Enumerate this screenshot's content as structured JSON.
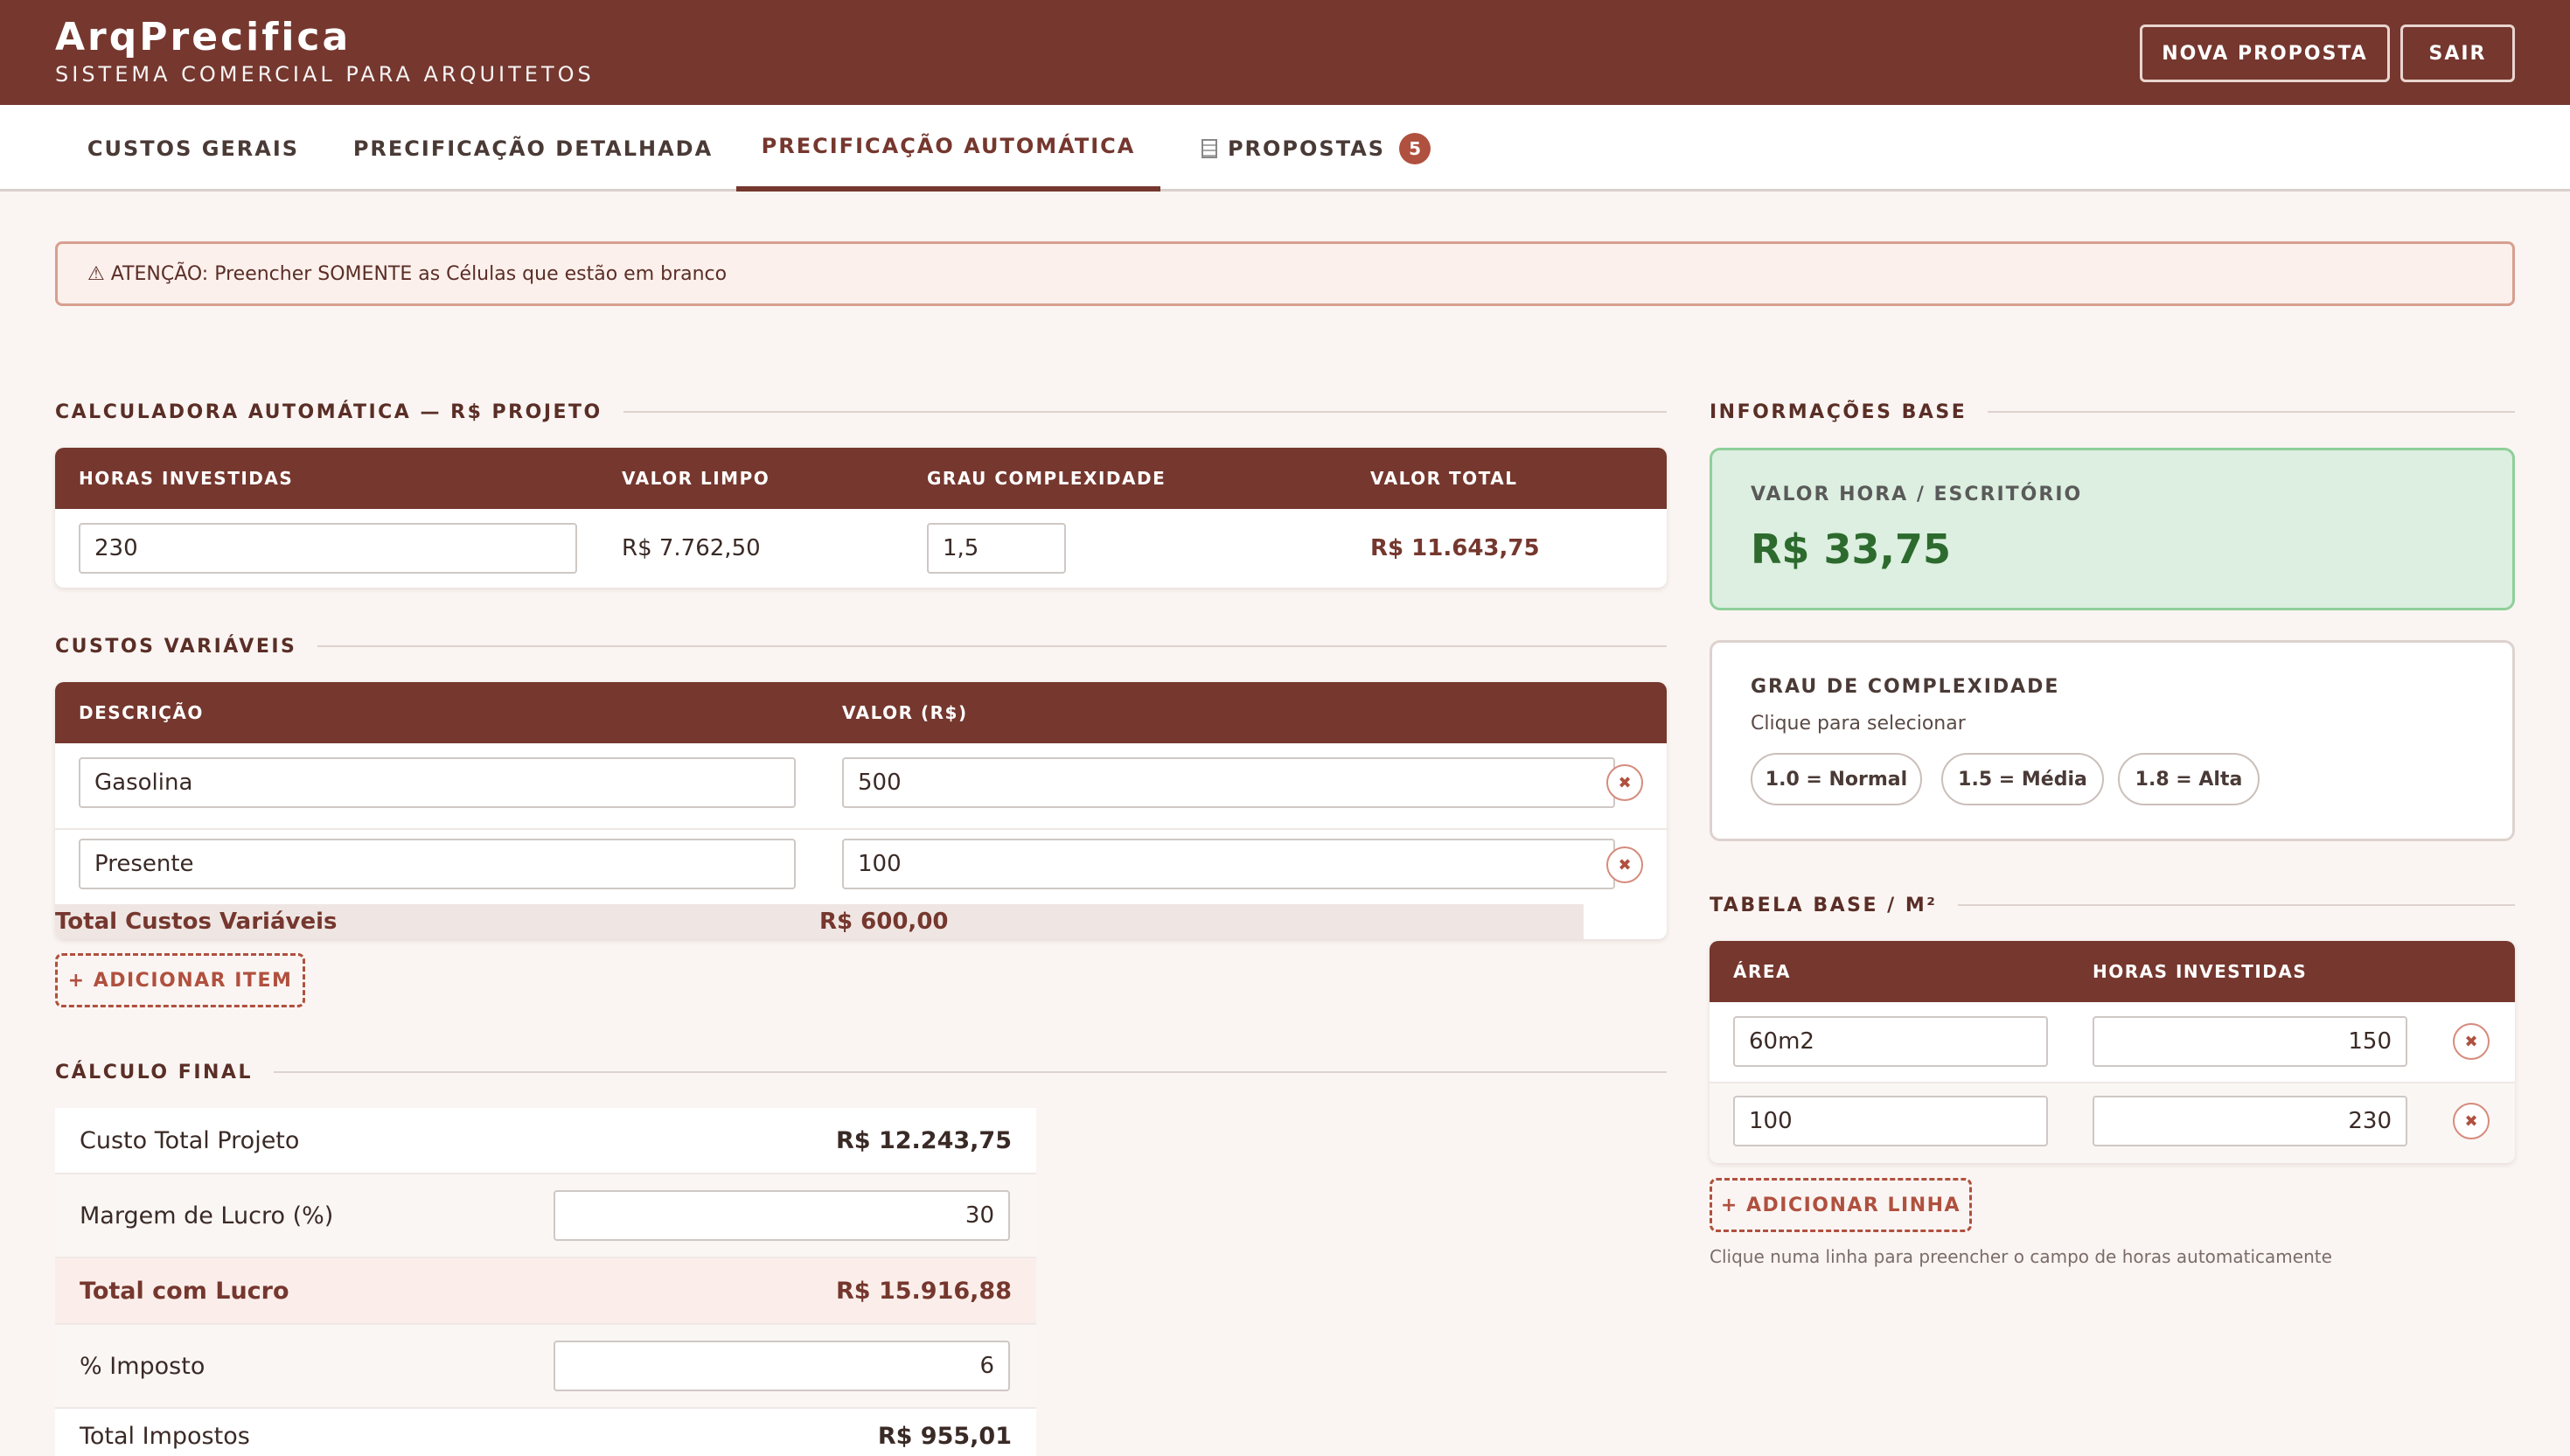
{
  "app": {
    "title": "ArqPrecifica",
    "subtitle": "SISTEMA COMERCIAL PARA ARQUITETOS"
  },
  "header_buttons": {
    "new_proposal": "NOVA PROPOSTA",
    "logout": "SAIR"
  },
  "tabs": [
    {
      "label": "CUSTOS GERAIS"
    },
    {
      "label": "PRECIFICAÇÃO DETALHADA"
    },
    {
      "label": "PRECIFICAÇÃO AUTOMÁTICA",
      "active": true
    },
    {
      "label": "PROPOSTAS",
      "badge": "5",
      "icon": "document-icon"
    }
  ],
  "alert": {
    "icon": "warning-icon",
    "text": "⚠ ATENÇÃO: Preencher SOMENTE as Células que estão em branco"
  },
  "calculator": {
    "title": "CALCULADORA AUTOMÁTICA — R$ PROJETO",
    "headers": {
      "hours": "HORAS INVESTIDAS",
      "clean_value": "VALOR LIMPO",
      "complexity": "GRAU COMPLEXIDADE",
      "total": "VALOR TOTAL"
    },
    "hours": "230",
    "clean_value": "R$ 7.762,50",
    "complexity": "1,5",
    "total": "R$ 11.643,75"
  },
  "variable_costs": {
    "title": "CUSTOS VARIÁVEIS",
    "headers": {
      "description": "DESCRIÇÃO",
      "value": "VALOR (R$)"
    },
    "rows": [
      {
        "description": "Gasolina",
        "value": "500"
      },
      {
        "description": "Presente",
        "value": "100"
      }
    ],
    "total_label": "Total Custos Variáveis",
    "total_value": "R$ 600,00",
    "add_label": "+ ADICIONAR ITEM"
  },
  "final_calc": {
    "title": "CÁLCULO FINAL",
    "total_cost_label": "Custo Total Projeto",
    "total_cost_value": "R$ 12.243,75",
    "margin_label": "Margem de Lucro (%)",
    "margin_value": "30",
    "with_profit_label": "Total com Lucro",
    "with_profit_value": "R$ 15.916,88",
    "tax_label": "% Imposto",
    "tax_value": "6",
    "taxes_label": "Total Impostos",
    "taxes_value": "R$ 955,01"
  },
  "base_info": {
    "title": "INFORMAÇÕES BASE",
    "hour_value_label": "VALOR HORA / ESCRITÓRIO",
    "hour_value": "R$ 33,75",
    "complexity_title": "GRAU DE COMPLEXIDADE",
    "complexity_hint": "Clique para selecionar",
    "complexity_options": [
      "1.0 = Normal",
      "1.5 = Média",
      "1.8 = Alta"
    ]
  },
  "base_table": {
    "title": "TABELA BASE / M²",
    "headers": {
      "area": "ÁREA",
      "hours": "HORAS INVESTIDAS"
    },
    "rows": [
      {
        "area": "60m2",
        "hours": "150"
      },
      {
        "area": "100",
        "hours": "230"
      }
    ],
    "add_label": "+ ADICIONAR LINHA",
    "hint": "Clique numa linha para preencher o campo de horas automaticamente"
  },
  "colors": {
    "brand": "#75372e",
    "accent": "#b0503f",
    "success_bg": "#dcefe0",
    "success_text": "#2d6a2e"
  }
}
